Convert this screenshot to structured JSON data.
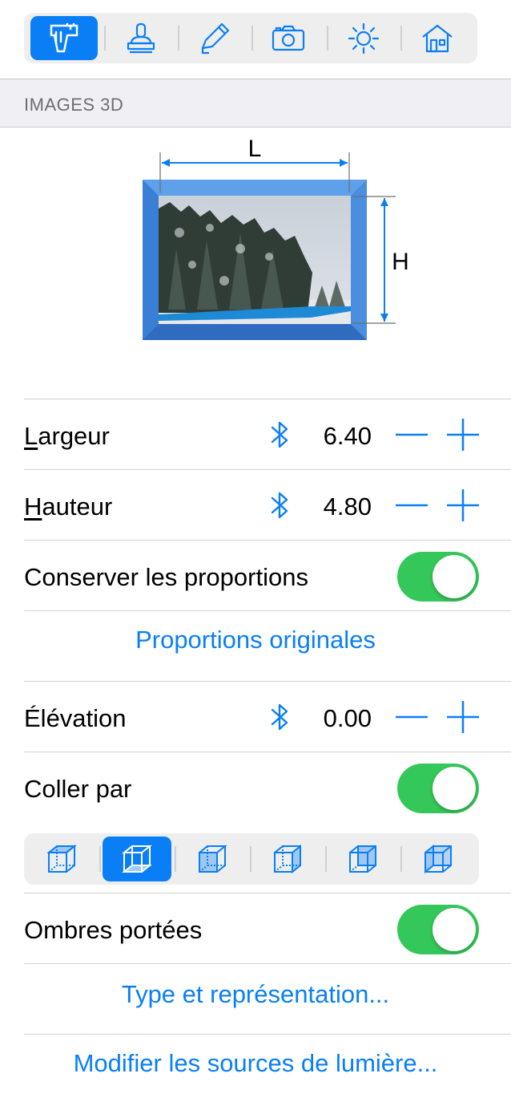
{
  "toolbar": {
    "items": [
      {
        "icon": "caliper-icon",
        "active": true
      },
      {
        "icon": "stamp-icon",
        "active": false
      },
      {
        "icon": "pencil-icon",
        "active": false
      },
      {
        "icon": "camera-icon",
        "active": false
      },
      {
        "icon": "sun-icon",
        "active": false
      },
      {
        "icon": "house-icon",
        "active": false
      }
    ]
  },
  "section": {
    "title": "IMAGES 3D"
  },
  "diagram": {
    "width_label": "L",
    "height_label": "H"
  },
  "rows": {
    "largeur": {
      "label_first": "L",
      "label_rest": "argeur",
      "value": "6.40"
    },
    "hauteur": {
      "label_first": "H",
      "label_rest": "auteur",
      "value": "4.80"
    },
    "conserver": {
      "label": "Conserver les proportions",
      "on": true
    },
    "proportions_link": "Proportions originales",
    "elevation": {
      "label": "Élévation",
      "value": "0.00"
    },
    "coller": {
      "label": "Coller par",
      "on": true
    },
    "ombres": {
      "label": "Ombres portées",
      "on": true
    },
    "type_link": "Type et représentation...",
    "lumiere_link": "Modifier les sources de lumière..."
  },
  "cube_selector": {
    "selected_index": 1
  },
  "colors": {
    "accent": "#0a7ff5",
    "toggle_on": "#34c759",
    "frame": "#3a7fd6"
  }
}
